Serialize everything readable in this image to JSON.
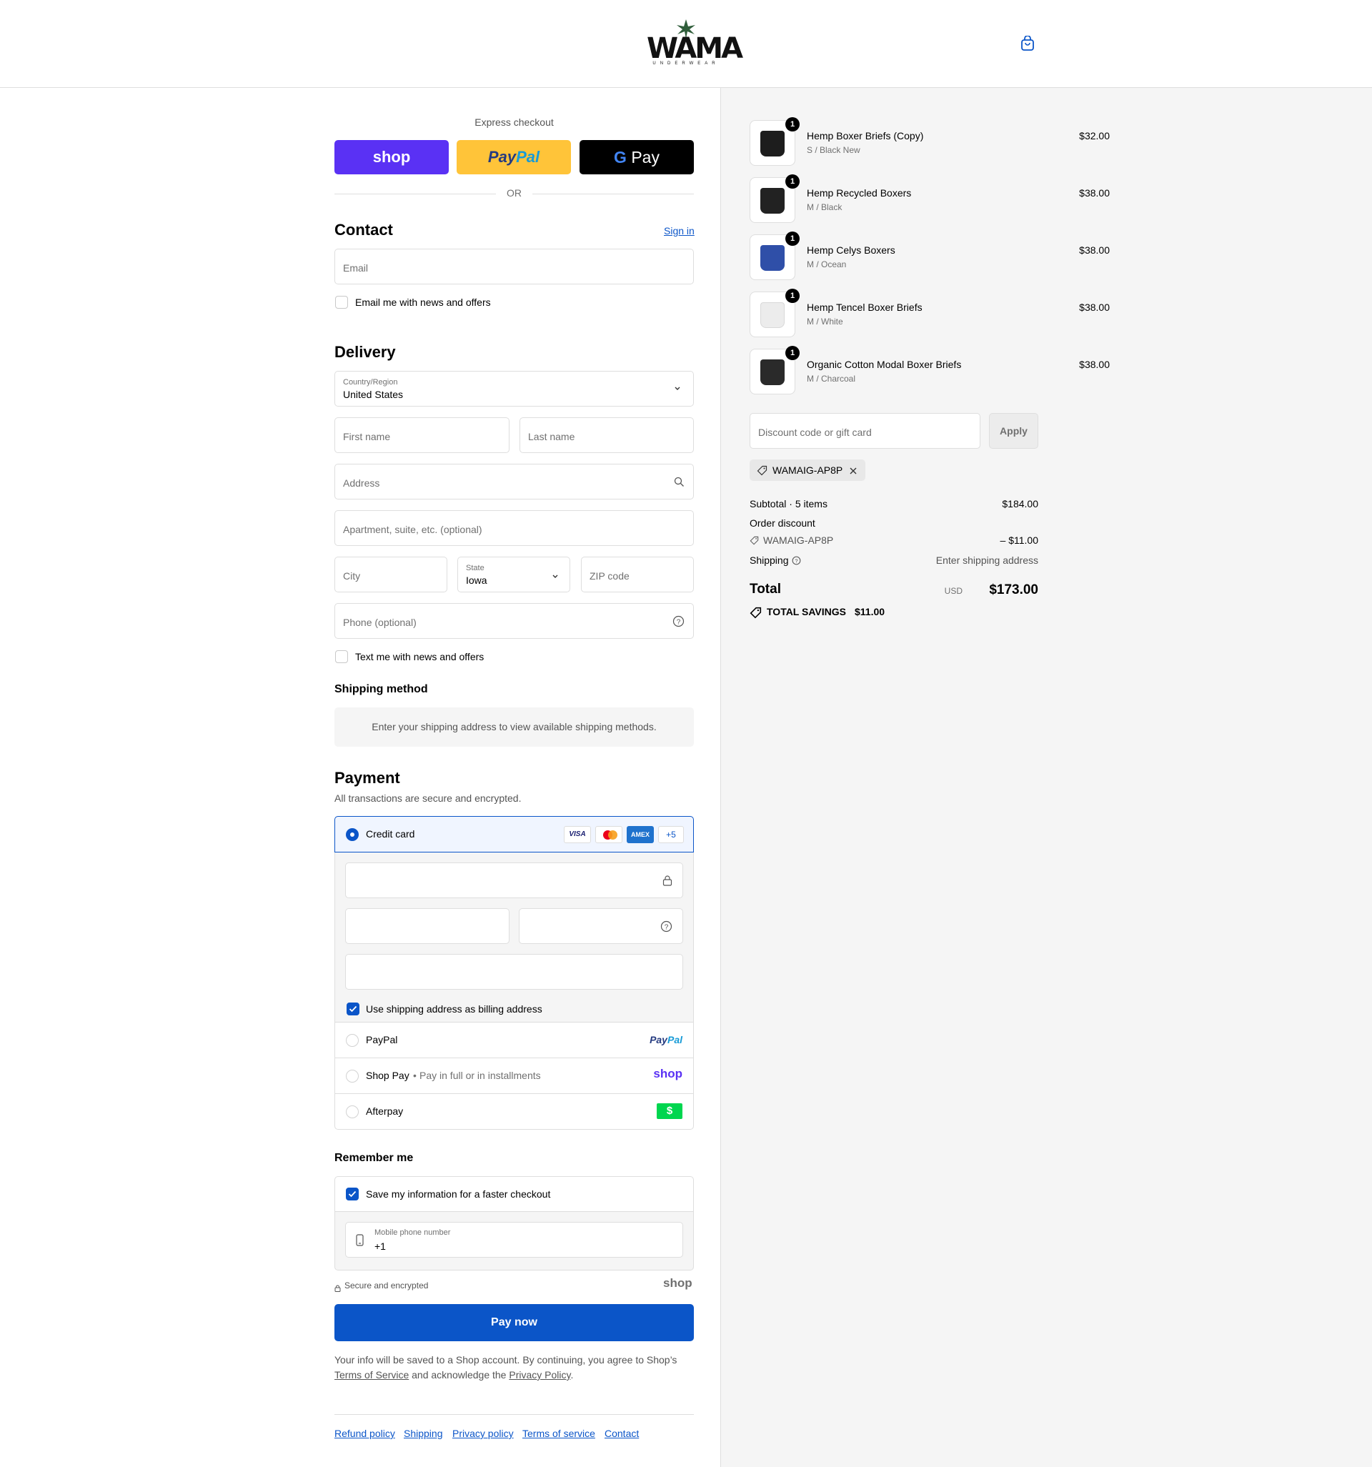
{
  "header": {
    "brand": "WAMA",
    "brand_sub": "UNDERWEAR",
    "cart_icon": "shopping-bag-icon"
  },
  "express": {
    "title": "Express checkout",
    "shop_label": "shop",
    "paypal_label_a": "Pay",
    "paypal_label_b": "Pal",
    "gpay_label": "Pay",
    "or": "OR"
  },
  "contact": {
    "title": "Contact",
    "sign_in": "Sign in",
    "email_placeholder": "Email",
    "news_label": "Email me with news and offers"
  },
  "delivery": {
    "title": "Delivery",
    "country_label": "Country/Region",
    "country_value": "United States",
    "first_name": "First name",
    "last_name": "Last name",
    "address": "Address",
    "apartment": "Apartment, suite, etc. (optional)",
    "city": "City",
    "state_label": "State",
    "state_value": "Iowa",
    "zip": "ZIP code",
    "phone": "Phone (optional)",
    "text_label": "Text me with news and offers"
  },
  "shipping_method": {
    "title": "Shipping method",
    "notice": "Enter your shipping address to view available shipping methods."
  },
  "payment": {
    "title": "Payment",
    "subtitle": "All transactions are secure and encrypted.",
    "credit_card": "Credit card",
    "card_visa": "VISA",
    "card_amex": "AMEX",
    "card_more": "+5",
    "billing_label": "Use shipping address as billing address",
    "paypal": "PayPal",
    "paypal_logo_a": "Pay",
    "paypal_logo_b": "Pal",
    "shoppay": "Shop Pay",
    "shoppay_sub": "Pay in full or in installments",
    "shoppay_logo": "shop",
    "afterpay": "Afterpay",
    "afterpay_logo": "$"
  },
  "remember": {
    "title": "Remember me",
    "save_label": "Save my information for a faster checkout",
    "mobile_label": "Mobile phone number",
    "mobile_value": "+1",
    "secure": "Secure and encrypted",
    "shop_logo": "shop"
  },
  "pay_button": "Pay now",
  "legal": {
    "text_a": "Your info will be saved to a Shop account. By continuing, you agree to Shop’s",
    "tos": "Terms of Service",
    "text_b": "and acknowledge the",
    "privacy": "Privacy Policy",
    "text_c": "."
  },
  "footer_links": [
    "Refund policy",
    "Shipping",
    "Privacy policy",
    "Terms of service",
    "Contact"
  ],
  "cart": {
    "items": [
      {
        "name": "Hemp Boxer Briefs (Copy)",
        "variant": "S / Black New",
        "price": "$32.00",
        "qty": "1",
        "color": "#1d1d1d"
      },
      {
        "name": "Hemp Recycled Boxers",
        "variant": "M / Black",
        "price": "$38.00",
        "qty": "1",
        "color": "#222222"
      },
      {
        "name": "Hemp Celys Boxers",
        "variant": "M / Ocean",
        "price": "$38.00",
        "qty": "1",
        "color": "#2f4fa8"
      },
      {
        "name": "Hemp Tencel Boxer Briefs",
        "variant": "M / White",
        "price": "$38.00",
        "qty": "1",
        "color": "#ececec"
      },
      {
        "name": "Organic Cotton Modal Boxer Briefs",
        "variant": "M / Charcoal",
        "price": "$38.00",
        "qty": "1",
        "color": "#2a2a2a"
      }
    ],
    "discount_placeholder": "Discount code or gift card",
    "apply": "Apply",
    "code": "WAMAIG-AP8P",
    "subtotal_label": "Subtotal · 5 items",
    "subtotal": "$184.00",
    "order_discount": "Order discount",
    "discount_code": "WAMAIG-AP8P",
    "discount_amount": "– $11.00",
    "shipping_label": "Shipping",
    "shipping_value": "Enter shipping address",
    "total_label": "Total",
    "currency": "USD",
    "total": "$173.00",
    "savings_label": "TOTAL SAVINGS",
    "savings": "$11.00"
  }
}
